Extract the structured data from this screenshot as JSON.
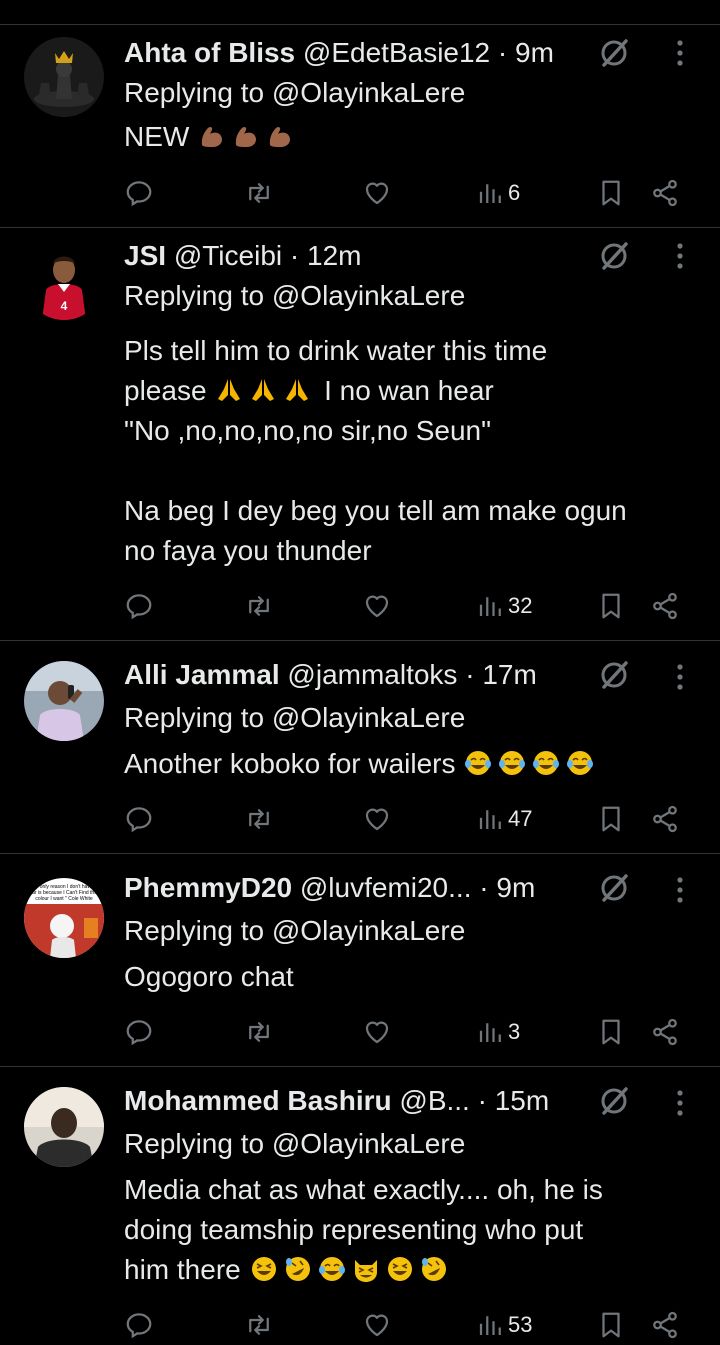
{
  "colors": {
    "background": "#000000",
    "text": "#e7e9ea",
    "muted": "#71767b",
    "divider": "#2f3336"
  },
  "replies": [
    {
      "name": "Ahta of Bliss",
      "handle": "@EdetBasie12",
      "dot": "·",
      "time": "9m",
      "replying_to": "Replying to @OlayinkaLere",
      "body": "NEW",
      "body_emojis": [
        "flexed-biceps",
        "flexed-biceps",
        "flexed-biceps"
      ],
      "views": "6",
      "avatar_icon": "chess-crown-avatar"
    },
    {
      "name": "JSI",
      "handle": "@Ticeibi",
      "dot": "·",
      "time": "12m",
      "replying_to": "Replying to @OlayinkaLere",
      "body_line1": "Pls tell him to drink water this time",
      "body_line2_pre": "please",
      "body_line2_emojis": [
        "folded-hands",
        "folded-hands",
        "folded-hands"
      ],
      "body_line2_post": "I no wan hear",
      "body_rest": "\"No ,no,no,no,no sir,no Seun\"\n\nNa beg I dey beg you tell am make ogun\nno faya you thunder",
      "views": "32",
      "avatar_icon": "footballer-avatar"
    },
    {
      "name": "Alli Jammal",
      "handle": "@jammaltoks",
      "dot": "·",
      "time": "17m",
      "replying_to": "Replying to @OlayinkaLere",
      "body": "Another koboko for wailers",
      "body_emojis": [
        "tears-of-joy",
        "tears-of-joy",
        "tears-of-joy",
        "tears-of-joy"
      ],
      "views": "47",
      "avatar_icon": "man-on-phone-avatar"
    },
    {
      "name": "PhemmyD20",
      "handle": "@luvfemi20...",
      "dot": "·",
      "time": "9m",
      "replying_to": "Replying to @OlayinkaLere",
      "body": "Ogogoro chat",
      "views": "3",
      "avatar_icon": "meme-avatar",
      "avatar_text": "The only reason I don't have a car is because I Can't Find the colour I want \" Cole White"
    },
    {
      "name": "Mohammed Bashiru",
      "handle": "@B...",
      "dot": "·",
      "time": "15m",
      "replying_to": "Replying to @OlayinkaLere",
      "body_line1": "Media chat as what exactly.... oh, he is",
      "body_line2": "doing teamship representing who put",
      "body_line3_pre": "him there",
      "body_line3_emojis": [
        "grinning-squinting",
        "rolling-on-floor-laughing",
        "tears-of-joy",
        "grinning-cat-smiling-eyes",
        "grinning-squinting",
        "rolling-on-floor-laughing"
      ],
      "views": "53",
      "avatar_icon": "man-portrait-avatar"
    }
  ]
}
